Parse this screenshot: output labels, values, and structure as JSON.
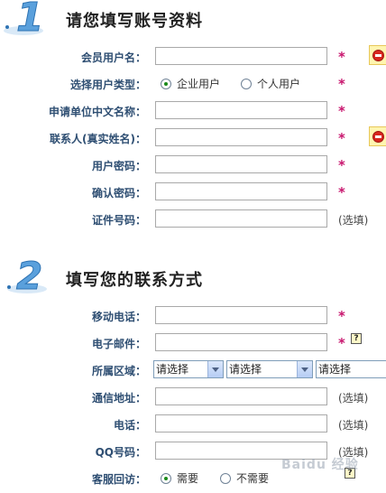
{
  "section1": {
    "badge": "1",
    "title": "请您填写账号资料",
    "fields": {
      "username": {
        "label": "会员用户名：",
        "required": "*"
      },
      "user_type": {
        "label": "选择用户类型：",
        "options": [
          "企业用户",
          "个人用户"
        ],
        "selected": "企业用户",
        "required": "*"
      },
      "org_name": {
        "label": "申请单位中文名称：",
        "required": "*"
      },
      "contact": {
        "label": "联系人(真实姓名)：",
        "required": "*"
      },
      "password": {
        "label": "用户密码：",
        "required": "*"
      },
      "confirm_password": {
        "label": "确认密码：",
        "required": "*"
      },
      "id_number": {
        "label": "证件号码：",
        "hint": "(选填)"
      }
    }
  },
  "section2": {
    "badge": "2",
    "title": "填写您的联系方式",
    "fields": {
      "mobile": {
        "label": "移动电话：",
        "required": "*"
      },
      "email": {
        "label": "电子邮件：",
        "required": "*",
        "help": "?"
      },
      "region": {
        "label": "所属区域：",
        "selects": [
          "请选择",
          "请选择",
          "请选择"
        ]
      },
      "address": {
        "label": "通信地址：",
        "hint": "(选填)"
      },
      "phone": {
        "label": "电话：",
        "hint": "(选填)"
      },
      "qq": {
        "label": "QQ号码：",
        "hint": "(选填)"
      },
      "callback": {
        "label": "客服回访：",
        "options": [
          "需要",
          "不需要"
        ],
        "selected": "需要",
        "help": "?"
      }
    }
  },
  "colors": {
    "label": "#2f4f73",
    "required": "#c8166e",
    "badge": "#5aa0dc",
    "error": "#d8261e"
  },
  "watermark": "Baidu 经验"
}
